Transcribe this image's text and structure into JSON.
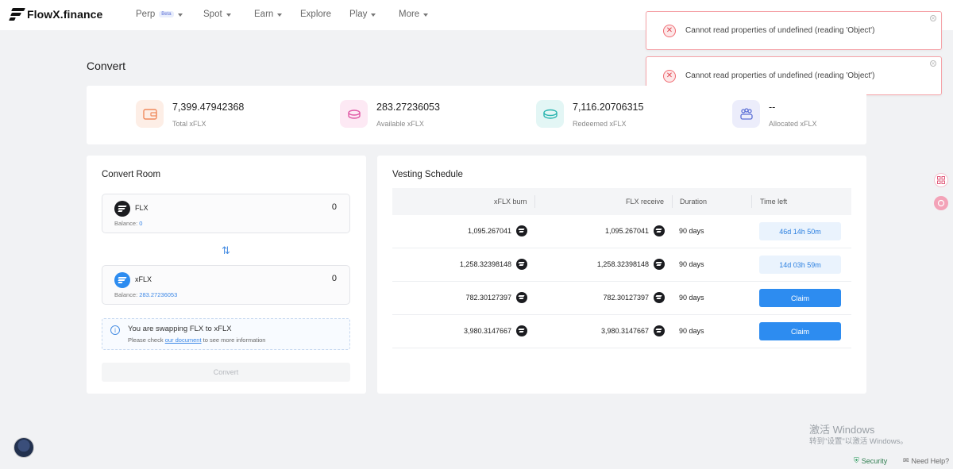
{
  "app": {
    "brand": "FlowX.finance"
  },
  "nav": {
    "items": [
      {
        "label": "Perp",
        "badge": "Beta",
        "dropdown": true
      },
      {
        "label": "Spot",
        "dropdown": true
      },
      {
        "label": "Earn",
        "dropdown": true
      },
      {
        "label": "Explore",
        "dropdown": false
      },
      {
        "label": "Play",
        "dropdown": true
      },
      {
        "label": "More",
        "dropdown": true
      }
    ]
  },
  "toasts": [
    {
      "message": "Cannot read properties of undefined (reading 'Object')"
    },
    {
      "message": "Cannot read properties of undefined (reading 'Object')"
    }
  ],
  "page": {
    "title": "Convert"
  },
  "stats": [
    {
      "value": "7,399.47942368",
      "label": "Total xFLX",
      "icon": "wallet-icon",
      "color": "#f08a5d"
    },
    {
      "value": "283.27236053",
      "label": "Available xFLX",
      "icon": "coins-icon",
      "color": "#e05aa6"
    },
    {
      "value": "7,116.20706315",
      "label": "Redeemed xFLX",
      "icon": "coin-stack-icon",
      "color": "#2bb5b0"
    },
    {
      "value": "--",
      "label": "Allocated xFLX",
      "icon": "allocation-icon",
      "color": "#5b6fd6"
    }
  ],
  "convert_room": {
    "title": "Convert Room",
    "from": {
      "token": "FLX",
      "amount": "0",
      "balance_label": "Balance:",
      "balance": "0"
    },
    "to": {
      "token": "xFLX",
      "amount": "0",
      "balance_label": "Balance:",
      "balance": "283.27236053"
    },
    "info": {
      "line1": "You are swapping FLX to xFLX",
      "line2_pre": "Please check",
      "line2_link": "our document",
      "line2_post": "to see more information"
    },
    "button_label": "Convert"
  },
  "vesting": {
    "title": "Vesting Schedule",
    "columns": [
      "xFLX burn",
      "FLX receive",
      "Duration",
      "Time left"
    ],
    "rows": [
      {
        "burn": "1,095.267041",
        "receive": "1,095.267041",
        "duration": "90 days",
        "time_left": "46d 14h 50m",
        "action": "time"
      },
      {
        "burn": "1,258.32398148",
        "receive": "1,258.32398148",
        "duration": "90 days",
        "time_left": "14d 03h 59m",
        "action": "time"
      },
      {
        "burn": "782.30127397",
        "receive": "782.30127397",
        "duration": "90 days",
        "time_left": "Claim",
        "action": "claim"
      },
      {
        "burn": "3,980.3147667",
        "receive": "3,980.3147667",
        "duration": "90 days",
        "time_left": "Claim",
        "action": "claim"
      }
    ]
  },
  "watermark": {
    "line1": "激活 Windows",
    "line2": "转到\"设置\"以激活 Windows。"
  },
  "footer": {
    "security": "Security",
    "help": "Need Help?"
  }
}
